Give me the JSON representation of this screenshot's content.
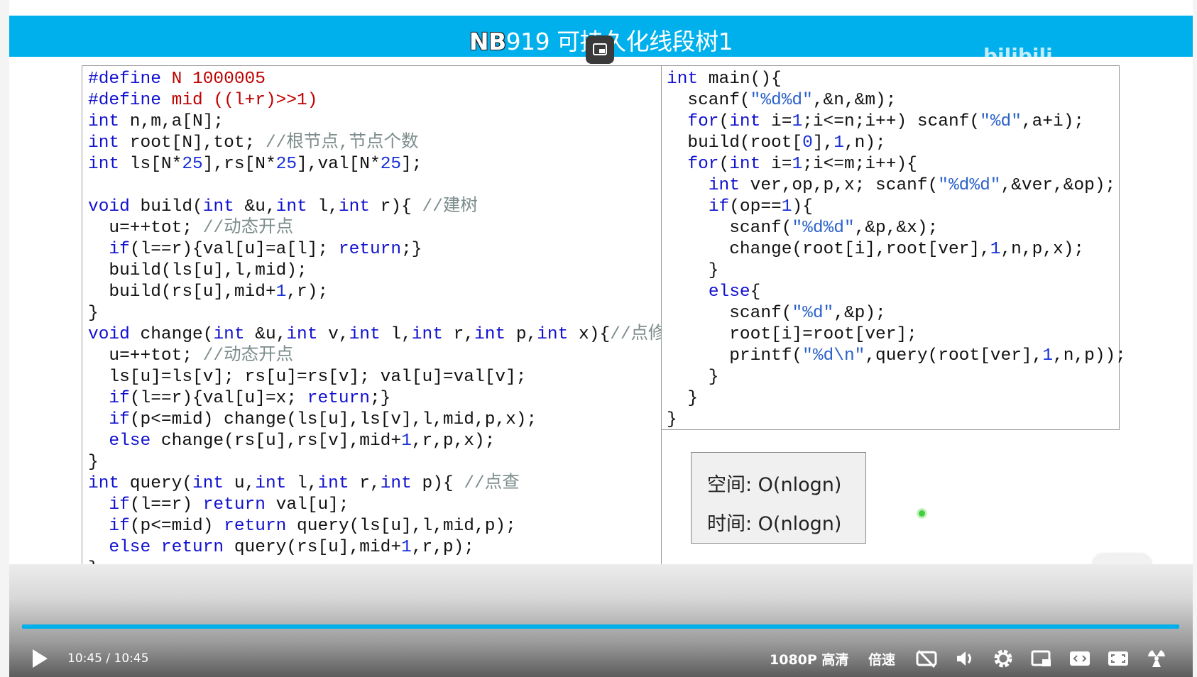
{
  "header": {
    "title_prefix": "NB",
    "title_rest": "919 可持久化线段树1",
    "brand_color": "#00b0ec",
    "watermark": "bilibili"
  },
  "left_code": [
    [
      [
        "k",
        "#define"
      ],
      [
        "d",
        " N 1000005"
      ]
    ],
    [
      [
        "k",
        "#define"
      ],
      [
        "d",
        " mid ((l+r)>>1)"
      ]
    ],
    [
      [
        "k",
        "int"
      ],
      [
        "p",
        " n,m,a[N];"
      ]
    ],
    [
      [
        "k",
        "int"
      ],
      [
        "p",
        " root[N],tot; "
      ],
      [
        "c",
        "//根节点,节点个数"
      ]
    ],
    [
      [
        "k",
        "int"
      ],
      [
        "p",
        " ls[N*"
      ],
      [
        "n",
        "25"
      ],
      [
        "p",
        "],rs[N*"
      ],
      [
        "n",
        "25"
      ],
      [
        "p",
        "],val[N*"
      ],
      [
        "n",
        "25"
      ],
      [
        "p",
        "];"
      ]
    ],
    [],
    [
      [
        "k",
        "void"
      ],
      [
        "p",
        " build("
      ],
      [
        "k",
        "int"
      ],
      [
        "p",
        " &u,"
      ],
      [
        "k",
        "int"
      ],
      [
        "p",
        " l,"
      ],
      [
        "k",
        "int"
      ],
      [
        "p",
        " r){ "
      ],
      [
        "c",
        "//建树"
      ]
    ],
    [
      [
        "p",
        "  u=++tot; "
      ],
      [
        "c",
        "//动态开点"
      ]
    ],
    [
      [
        "p",
        "  "
      ],
      [
        "k",
        "if"
      ],
      [
        "p",
        "(l==r){val[u]=a[l]; "
      ],
      [
        "k",
        "return"
      ],
      [
        "p",
        ";}"
      ]
    ],
    [
      [
        "p",
        "  build(ls[u],l,mid);"
      ]
    ],
    [
      [
        "p",
        "  build(rs[u],mid+"
      ],
      [
        "n",
        "1"
      ],
      [
        "p",
        ",r);"
      ]
    ],
    [
      [
        "p",
        "}"
      ]
    ],
    [
      [
        "k",
        "void"
      ],
      [
        "p",
        " change("
      ],
      [
        "k",
        "int"
      ],
      [
        "p",
        " &u,"
      ],
      [
        "k",
        "int"
      ],
      [
        "p",
        " v,"
      ],
      [
        "k",
        "int"
      ],
      [
        "p",
        " l,"
      ],
      [
        "k",
        "int"
      ],
      [
        "p",
        " r,"
      ],
      [
        "k",
        "int"
      ],
      [
        "p",
        " p,"
      ],
      [
        "k",
        "int"
      ],
      [
        "p",
        " x){"
      ],
      [
        "c",
        "//点修"
      ]
    ],
    [
      [
        "p",
        "  u=++tot; "
      ],
      [
        "c",
        "//动态开点"
      ]
    ],
    [
      [
        "p",
        "  ls[u]=ls[v]; rs[u]=rs[v]; val[u]=val[v];"
      ]
    ],
    [
      [
        "p",
        "  "
      ],
      [
        "k",
        "if"
      ],
      [
        "p",
        "(l==r){val[u]=x; "
      ],
      [
        "k",
        "return"
      ],
      [
        "p",
        ";}"
      ]
    ],
    [
      [
        "p",
        "  "
      ],
      [
        "k",
        "if"
      ],
      [
        "p",
        "(p<=mid) change(ls[u],ls[v],l,mid,p,x);"
      ]
    ],
    [
      [
        "p",
        "  "
      ],
      [
        "k",
        "else"
      ],
      [
        "p",
        " change(rs[u],rs[v],mid+"
      ],
      [
        "n",
        "1"
      ],
      [
        "p",
        ",r,p,x);"
      ]
    ],
    [
      [
        "p",
        "}"
      ]
    ],
    [
      [
        "k",
        "int"
      ],
      [
        "p",
        " query("
      ],
      [
        "k",
        "int"
      ],
      [
        "p",
        " u,"
      ],
      [
        "k",
        "int"
      ],
      [
        "p",
        " l,"
      ],
      [
        "k",
        "int"
      ],
      [
        "p",
        " r,"
      ],
      [
        "k",
        "int"
      ],
      [
        "p",
        " p){ "
      ],
      [
        "c",
        "//点查"
      ]
    ],
    [
      [
        "p",
        "  "
      ],
      [
        "k",
        "if"
      ],
      [
        "p",
        "(l==r) "
      ],
      [
        "k",
        "return"
      ],
      [
        "p",
        " val[u];"
      ]
    ],
    [
      [
        "p",
        "  "
      ],
      [
        "k",
        "if"
      ],
      [
        "p",
        "(p<=mid) "
      ],
      [
        "k",
        "return"
      ],
      [
        "p",
        " query(ls[u],l,mid,p);"
      ]
    ],
    [
      [
        "p",
        "  "
      ],
      [
        "k",
        "else"
      ],
      [
        "p",
        " "
      ],
      [
        "k",
        "return"
      ],
      [
        "p",
        " query(rs[u],mid+"
      ],
      [
        "n",
        "1"
      ],
      [
        "p",
        ",r,p);"
      ]
    ],
    [
      [
        "p",
        "}"
      ]
    ]
  ],
  "right_code": [
    [
      [
        "k",
        "int"
      ],
      [
        "p",
        " main(){"
      ]
    ],
    [
      [
        "p",
        "  scanf("
      ],
      [
        "s",
        "\"%d%d\""
      ],
      [
        "p",
        ",&n,&m);"
      ]
    ],
    [
      [
        "p",
        "  "
      ],
      [
        "k",
        "for"
      ],
      [
        "p",
        "("
      ],
      [
        "k",
        "int"
      ],
      [
        "p",
        " i="
      ],
      [
        "n",
        "1"
      ],
      [
        "p",
        ";i<=n;i++) scanf("
      ],
      [
        "s",
        "\"%d\""
      ],
      [
        "p",
        ",a+i);"
      ]
    ],
    [
      [
        "p",
        "  build(root["
      ],
      [
        "n",
        "0"
      ],
      [
        "p",
        "],"
      ],
      [
        "n",
        "1"
      ],
      [
        "p",
        ",n);"
      ]
    ],
    [
      [
        "p",
        "  "
      ],
      [
        "k",
        "for"
      ],
      [
        "p",
        "("
      ],
      [
        "k",
        "int"
      ],
      [
        "p",
        " i="
      ],
      [
        "n",
        "1"
      ],
      [
        "p",
        ";i<=m;i++){"
      ]
    ],
    [
      [
        "p",
        "    "
      ],
      [
        "k",
        "int"
      ],
      [
        "p",
        " ver,op,p,x; scanf("
      ],
      [
        "s",
        "\"%d%d\""
      ],
      [
        "p",
        ",&ver,&op);"
      ]
    ],
    [
      [
        "p",
        "    "
      ],
      [
        "k",
        "if"
      ],
      [
        "p",
        "(op=="
      ],
      [
        "n",
        "1"
      ],
      [
        "p",
        "){"
      ]
    ],
    [
      [
        "p",
        "      scanf("
      ],
      [
        "s",
        "\"%d%d\""
      ],
      [
        "p",
        ",&p,&x);"
      ]
    ],
    [
      [
        "p",
        "      change(root[i],root[ver],"
      ],
      [
        "n",
        "1"
      ],
      [
        "p",
        ",n,p,x);"
      ]
    ],
    [
      [
        "p",
        "    }"
      ]
    ],
    [
      [
        "p",
        "    "
      ],
      [
        "k",
        "else"
      ],
      [
        "p",
        "{"
      ]
    ],
    [
      [
        "p",
        "      scanf("
      ],
      [
        "s",
        "\"%d\""
      ],
      [
        "p",
        ",&p);"
      ]
    ],
    [
      [
        "p",
        "      root[i]=root[ver];"
      ]
    ],
    [
      [
        "p",
        "      printf("
      ],
      [
        "s",
        "\"%d\\n\""
      ],
      [
        "p",
        ",query(root[ver],"
      ],
      [
        "n",
        "1"
      ],
      [
        "p",
        ",n,p));"
      ]
    ],
    [
      [
        "p",
        "    }"
      ]
    ],
    [
      [
        "p",
        "  }"
      ]
    ],
    [
      [
        "p",
        "}"
      ]
    ]
  ],
  "complexity": {
    "space": "空间:  O(nlogn)",
    "time": "时间:  O(nlogn)"
  },
  "player": {
    "progress_percent": 100,
    "time": "10:45 / 10:45",
    "quality": "1080P 高清",
    "speed": "倍速",
    "icons": [
      "play-icon",
      "subtitle-off-icon",
      "volume-icon",
      "settings-icon",
      "picture-in-picture-icon",
      "widescreen-icon",
      "fullscreen-icon",
      "danmaku-icon"
    ]
  }
}
